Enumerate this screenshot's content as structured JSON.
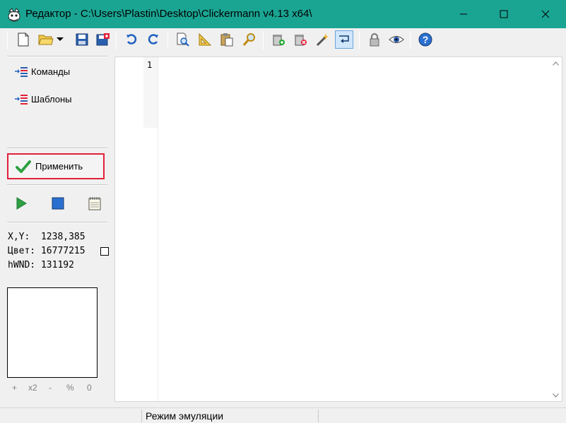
{
  "window": {
    "title": "Редактор - C:\\Users\\Plastin\\Desktop\\Clickermann v4.13 x64\\",
    "titlebar_color": "#1aa593"
  },
  "toolbar": {
    "buttons": [
      {
        "name": "new-file",
        "icon": "blank-page-icon"
      },
      {
        "name": "open-file",
        "icon": "folder-open-icon"
      },
      {
        "name": "open-dropdown",
        "icon": "dropdown-arrow-icon"
      },
      {
        "name": "save",
        "icon": "floppy-icon"
      },
      {
        "name": "save-as",
        "icon": "floppy-red-icon"
      },
      {
        "name": "undo",
        "icon": "undo-icon"
      },
      {
        "name": "redo",
        "icon": "redo-icon"
      },
      {
        "name": "find",
        "icon": "find-page-icon"
      },
      {
        "name": "ruler",
        "icon": "ruler-triangle-icon"
      },
      {
        "name": "paste",
        "icon": "clipboard-icon"
      },
      {
        "name": "search",
        "icon": "magnifier-icon"
      },
      {
        "name": "add-trash",
        "icon": "trash-add-icon"
      },
      {
        "name": "delete-trash",
        "icon": "trash-delete-icon"
      },
      {
        "name": "magic-wand",
        "icon": "wand-icon"
      },
      {
        "name": "word-wrap",
        "icon": "wrap-icon",
        "pressed": true
      },
      {
        "name": "lock",
        "icon": "lock-icon"
      },
      {
        "name": "view",
        "icon": "eye-icon"
      },
      {
        "name": "help",
        "icon": "help-icon"
      }
    ]
  },
  "sidebar": {
    "items": [
      {
        "label": "Команды",
        "icon": "commands-icon"
      },
      {
        "label": "Шаблоны",
        "icon": "templates-icon"
      }
    ],
    "apply_label": "Применить",
    "apply_highlight_color": "#e3203a"
  },
  "run_controls": [
    {
      "name": "play",
      "icon": "play-icon"
    },
    {
      "name": "stop",
      "icon": "stop-icon"
    },
    {
      "name": "notes",
      "icon": "notepad-icon"
    }
  ],
  "info": {
    "xy_label": "X,Y:",
    "xy_value": "1238,385",
    "color_label": "Цвет:",
    "color_value": "16777215",
    "hwnd_label": "hWND:",
    "hwnd_value": "131192"
  },
  "zoom": {
    "plus": "+",
    "x2": "x2",
    "minus": "-",
    "percent": "%",
    "zero": "0"
  },
  "editor": {
    "line_numbers": [
      "1"
    ],
    "content": ""
  },
  "status": {
    "mode": "Режим эмуляции"
  }
}
